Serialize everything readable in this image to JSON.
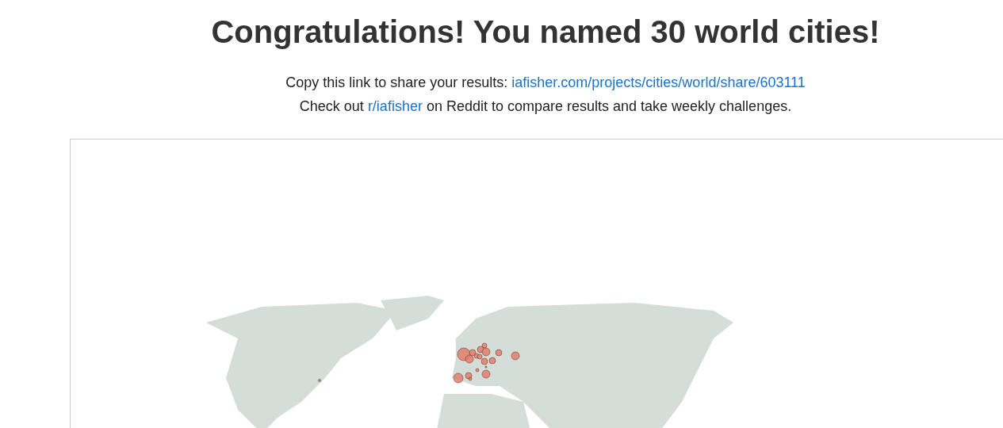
{
  "title": "Congratulations! You named 30 world cities!",
  "share": {
    "label": "Copy this link to share your results:",
    "link": "iafisher.com/projects/cities/world/share/603111"
  },
  "reddit": {
    "before": "Check out",
    "link": "r/iafisher",
    "after": "on Reddit to compare results and take weekly challenges."
  }
}
